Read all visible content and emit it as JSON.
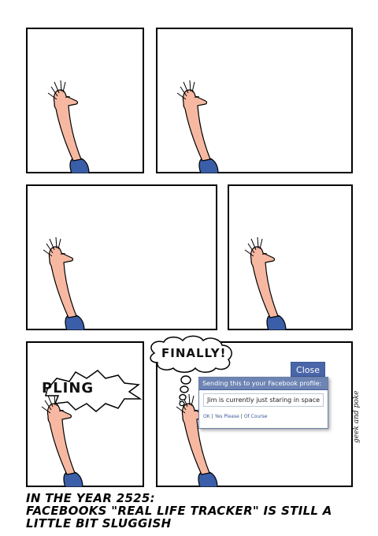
{
  "comic": {
    "sound_effect": "PLING",
    "thought": "FINALLY!",
    "signature": "geek and poke",
    "caption": [
      "IN THE YEAR 2525:",
      "FACEBOOKS \"REAL LIFE TRACKER\" IS STILL A",
      "LITTLE BIT SLUGGISH"
    ]
  },
  "dialog": {
    "close_label": "Close",
    "header": "Sending this to your Facebook profile:",
    "message": "Jim is currently just staring in space",
    "actions": [
      "OK",
      "Yes Please",
      "Of Course"
    ]
  },
  "colors": {
    "skin": "#f7b8a2",
    "shirt": "#3b5ea8",
    "facebook_blue": "#6d84b4",
    "facebook_dark": "#3b5998"
  }
}
